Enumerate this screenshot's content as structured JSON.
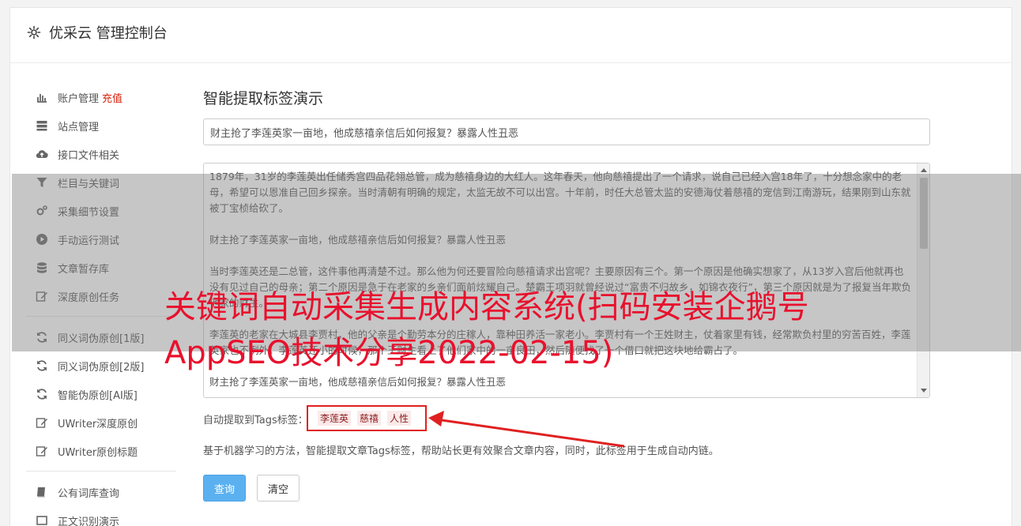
{
  "header": {
    "title": "优采云 管理控制台"
  },
  "sidebar": {
    "group1": [
      {
        "label": "账户管理",
        "extra": "充值",
        "icon": "bar-chart-icon"
      },
      {
        "label": "站点管理",
        "extra": "",
        "icon": "server-icon"
      },
      {
        "label": "接口文件相关",
        "extra": "",
        "icon": "cloud-upload-icon"
      },
      {
        "label": "栏目与关键词",
        "extra": "",
        "icon": "filter-icon"
      },
      {
        "label": "采集细节设置",
        "extra": "",
        "icon": "cogs-icon"
      },
      {
        "label": "手动运行测试",
        "extra": "",
        "icon": "play-circle-icon"
      },
      {
        "label": "文章暂存库",
        "extra": "",
        "icon": "database-icon"
      },
      {
        "label": "深度原创任务",
        "extra": "",
        "icon": "edit-icon"
      }
    ],
    "group2": [
      {
        "label": "同义词伪原创[1版]",
        "icon": "refresh-icon"
      },
      {
        "label": "同义词伪原创[2版]",
        "icon": "refresh-icon"
      },
      {
        "label": "智能伪原创[AI版]",
        "icon": "refresh-icon"
      },
      {
        "label": "UWriter深度原创",
        "icon": "edit-icon"
      },
      {
        "label": "UWriter原创标题",
        "icon": "edit-icon"
      }
    ],
    "group3": [
      {
        "label": "公有词库查询",
        "icon": "book-icon"
      },
      {
        "label": "正文识别演示",
        "icon": "square-icon"
      }
    ]
  },
  "main": {
    "heading": "智能提取标签演示",
    "title_value": "财主抢了李莲英家一亩地，他成慈禧亲信后如何报复？暴露人性丑恶",
    "article": [
      "1879年，31岁的李莲英出任储秀宫四品花翎总管，成为慈禧身边的大红人。这年春天，他向慈禧提出了一个请求，说自己已经入宫18年了，十分想念家中的老母，希望可以恩准自己回乡探亲。当时清朝有明确的规定，太监无故不可以出宫。十年前，时任大总管太监的安德海仗着慈禧的宠信到江南游玩，结果刚到山东就被丁宝桢给砍了。",
      "财主抢了李莲英家一亩地，他成慈禧亲信后如何报复？暴露人性丑恶",
      "当时李莲英还是二总管，这件事他再清楚不过。那么他为何还要冒险向慈禧请求出宫呢？主要原因有三个。第一个原因是他确实想家了，从13岁入宫后他就再也没有见过自己的母亲；第二个原因是急于在老家的乡亲们面前炫耀自己。楚霸王项羽就曾经说过“富贵不归故乡，如锦衣夜行”，第三个原因就是为了报复当年欺负他家的财主。",
      "李莲英的老家在大城县李贾村，他的父亲是个勤劳本分的庄稼人，靠种田养活一家老小。李贾村有一个王姓财主，仗着家里有钱，经常欺负村里的穷苦百姓，李莲英家也不例外。李莲英还小的时候，那个王财主看上了他们家中的一亩良田，然后随便找了一个借口就把这块地给霸占了。",
      "财主抢了李莲英家一亩地，他成慈禧亲信后如何报复？暴露人性丑恶"
    ],
    "tags_label": "自动提取到Tags标签：",
    "tags": [
      "李莲英",
      "慈禧",
      "人性"
    ],
    "description": "基于机器学习的方法，智能提取文章Tags标签，帮助站长更有效聚合文章内容，同时，此标签用于生成自动内链。",
    "query_button": "查询",
    "clear_button": "清空"
  },
  "overlay": {
    "watermark": "关键词自动采集生成内容系统(扫码安装企鹅号AppSEO技术分享2022-02-15)"
  },
  "colors": {
    "accent_red": "#e8112d",
    "primary_button": "#5bb1f0",
    "tag_border": "#e02020"
  }
}
